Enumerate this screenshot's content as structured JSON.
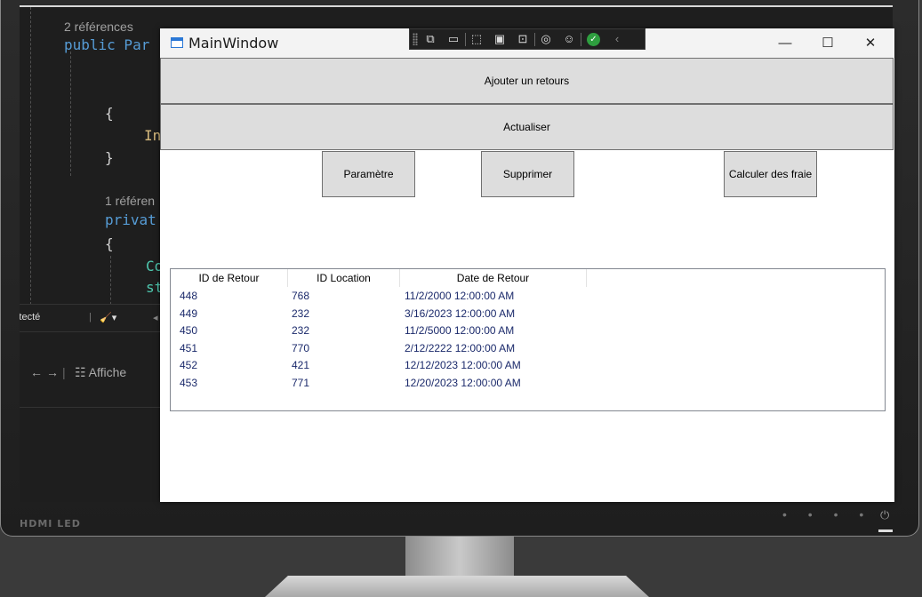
{
  "monitor": {
    "brand_label": "HDMI LED",
    "power_icon": "power-icon"
  },
  "code_editor": {
    "line_refs_1": "2 références",
    "line_public": "public Par",
    "brace_open_1": "{",
    "line_in": "In",
    "brace_close_1": "}",
    "line_refs_2": "1 référen",
    "line_private": "privat",
    "brace_open_2": "{",
    "line_co": "Co",
    "line_st": "st"
  },
  "ide_status": {
    "detected_text": "e détecté",
    "brush_icon": "brush-icon",
    "search_icon": "search-icon",
    "back_icon": "arrow-left-icon",
    "forward_icon": "arrow-right-icon",
    "view_text": "Affiche"
  },
  "window": {
    "title": "MainWindow",
    "minimize_glyph": "—",
    "maximize_glyph": "☐",
    "close_glyph": "✕"
  },
  "debug_toolbar": {
    "icons": [
      "select-element-icon",
      "camera-icon",
      "pointer-icon",
      "display-layout-icon",
      "track-focus-icon",
      "hot-reload-icon",
      "accessibility-icon",
      "check-icon",
      "collapse-icon"
    ]
  },
  "buttons": {
    "add_return": "Ajouter un retours",
    "refresh": "Actualiser",
    "settings": "Paramètre",
    "delete": "Supprimer",
    "compute_fees": "Calculer des fraie"
  },
  "table": {
    "columns": [
      "ID de Retour",
      "ID Location",
      "Date de Retour"
    ],
    "rows": [
      [
        "448",
        "768",
        "11/2/2000 12:00:00 AM"
      ],
      [
        "449",
        "232",
        "3/16/2023 12:00:00 AM"
      ],
      [
        "450",
        "232",
        "11/2/5000 12:00:00 AM"
      ],
      [
        "451",
        "770",
        "2/12/2222 12:00:00 AM"
      ],
      [
        "452",
        "421",
        "12/12/2023 12:00:00 AM"
      ],
      [
        "453",
        "771",
        "12/20/2023 12:00:00 AM"
      ]
    ]
  },
  "colors": {
    "cell_text": "#1b2a6b",
    "button_bg": "#dddddd",
    "code_keyword": "#569cd6"
  }
}
